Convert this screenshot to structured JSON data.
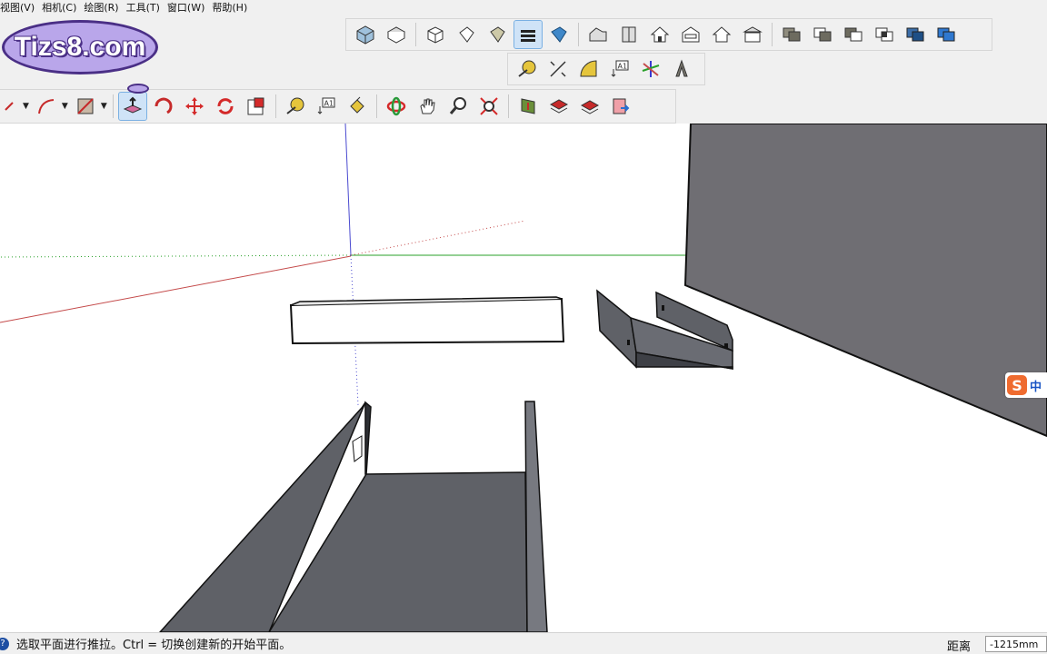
{
  "menu": [
    "视图(V)",
    "相机(C)",
    "绘图(R)",
    "工具(T)",
    "窗口(W)",
    "帮助(H)"
  ],
  "watermark": {
    "text": "Tizs8.com"
  },
  "ime": {
    "logo": "S",
    "mode": "中"
  },
  "toolbars": {
    "views_row": [
      "iso-view-icon",
      "top-view-icon",
      "front-view-icon",
      "right-view-icon",
      "back-view-icon",
      "left-view-icon",
      "xray-style-icon",
      "wireframe-style-icon",
      "hidden-line-style-icon",
      "shaded-style-icon",
      "textured-style-icon",
      "monochrome-style-icon"
    ],
    "construction_row": [
      "tape-measure-icon",
      "dimension-icon",
      "protractor-icon",
      "text-icon",
      "axes-icon",
      "3d-text-icon"
    ],
    "main_row": [
      "pencil-icon",
      "arc-icon",
      "rectangle-icon",
      "push-pull-icon",
      "follow-me-icon",
      "move-icon",
      "rotate-icon",
      "scale-icon",
      "tape-measure-icon",
      "text-icon",
      "paint-bucket-icon",
      "orbit-icon",
      "pan-icon",
      "zoom-icon",
      "zoom-extents-icon",
      "get-models-icon",
      "share-model-icon",
      "components-icon",
      "send-to-layout-icon"
    ],
    "active_tool": "push-pull-icon"
  },
  "status": {
    "icon": "?",
    "text": "选取平面进行推拉。Ctrl = 切换创建新的开始平面。",
    "measure_label": "距离",
    "measure_value": "-1215mm"
  },
  "colors": {
    "axis_red": "#c44a4a",
    "axis_green": "#2aa02a",
    "axis_blue": "#4a4ad0",
    "wall": "#6f6e73",
    "channel_dark": "#5f6167",
    "channel_face": "#6a6c73"
  }
}
